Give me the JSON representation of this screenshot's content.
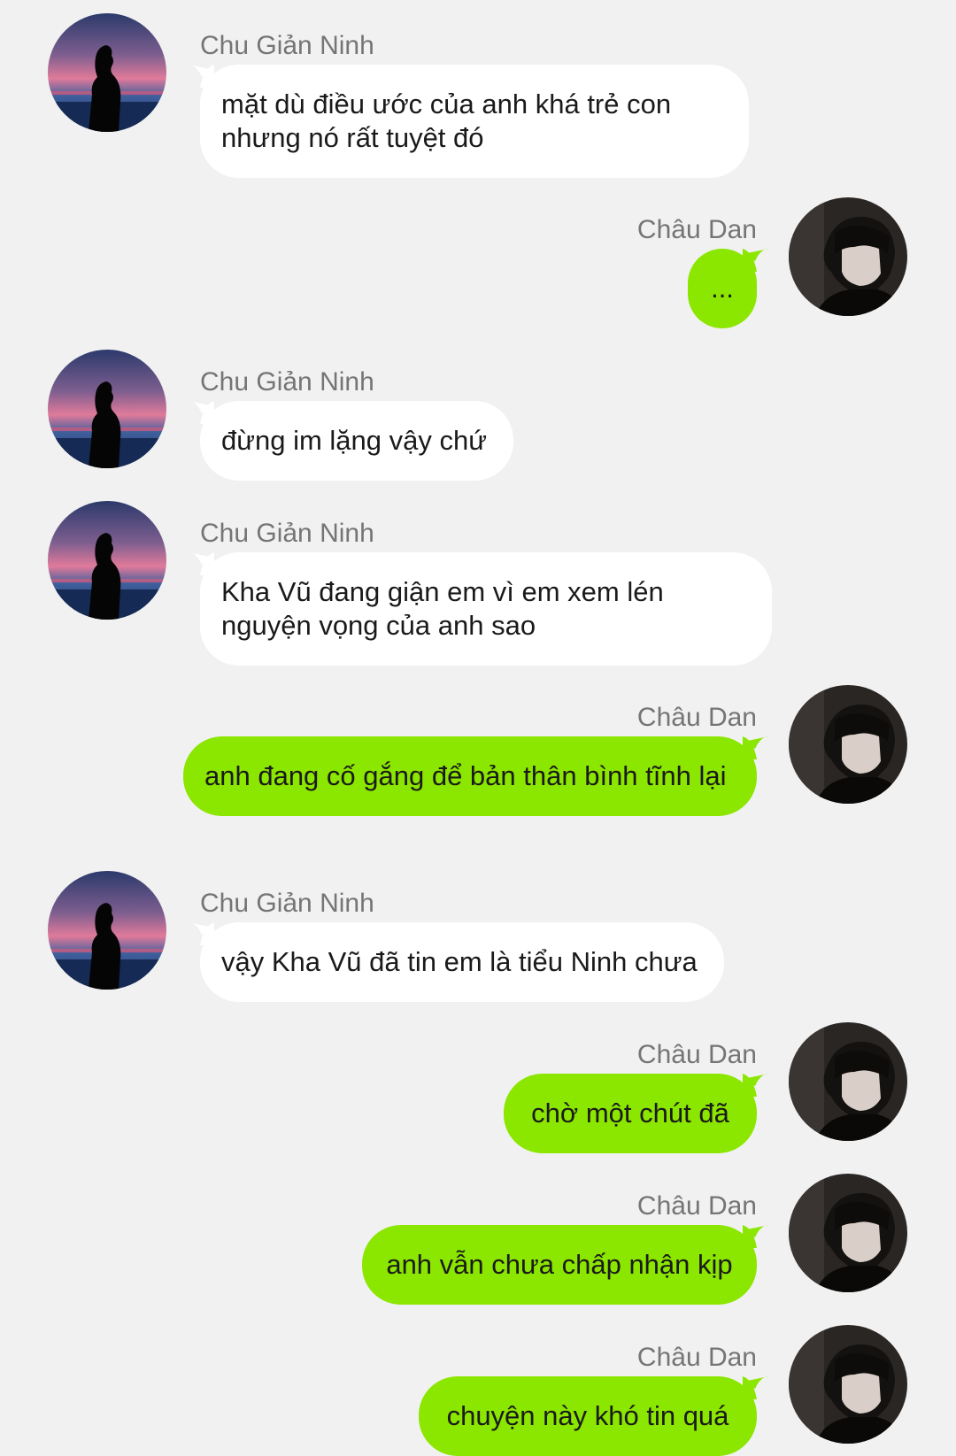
{
  "participants": {
    "left_name": "Chu Giản Ninh",
    "right_name": "Châu Dan"
  },
  "messages": [
    {
      "side": "left",
      "sender": "Chu Giản Ninh",
      "text": "mặt dù điều ước của anh khá trẻ con nhưng nó rất tuyệt đó"
    },
    {
      "side": "right",
      "sender": "Châu Dan",
      "text": "..."
    },
    {
      "side": "left",
      "sender": "Chu Giản Ninh",
      "text": "đừng im lặng vậy chứ"
    },
    {
      "side": "left",
      "sender": "Chu Giản Ninh",
      "text": "Kha Vũ đang giận em vì em xem lén nguyện vọng của anh sao"
    },
    {
      "side": "right",
      "sender": "Châu Dan",
      "text": "anh đang cố gắng để bản thân bình tĩnh lại"
    },
    {
      "side": "left",
      "sender": "Chu Giản Ninh",
      "text": "vậy Kha Vũ đã tin em là tiểu Ninh chưa"
    },
    {
      "side": "right",
      "sender": "Châu Dan",
      "text": "chờ một chút đã"
    },
    {
      "side": "right",
      "sender": "Châu Dan",
      "text": "anh vẫn chưa chấp nhận kịp"
    },
    {
      "side": "right",
      "sender": "Châu Dan",
      "text": "chuyện này khó tin quá"
    }
  ],
  "colors": {
    "background": "#f1f1f1",
    "left_bubble": "#ffffff",
    "right_bubble": "#8be600",
    "sender_text": "#757575",
    "message_text": "#1a1a1a"
  },
  "icons": {
    "left_avatar": "silhouette-sunset-avatar",
    "right_avatar": "dark-portrait-avatar"
  }
}
